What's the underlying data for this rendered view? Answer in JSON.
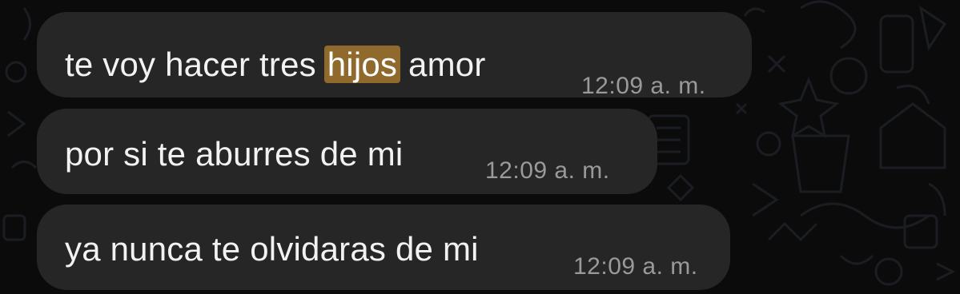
{
  "messages": [
    {
      "text_before": "te voy hacer tres ",
      "highlight": "hijos",
      "text_after": " amor",
      "time": "12:09 a. m."
    },
    {
      "text": "por si te aburres de mi",
      "time": "12:09 a. m."
    },
    {
      "text": "ya nunca te olvidaras de mi",
      "time": "12:09 a. m."
    }
  ],
  "colors": {
    "background": "#0b0b0b",
    "bubble": "#262626",
    "text": "#f2f2f2",
    "timestamp": "#9a9a9a",
    "highlight": "#8f6a2c"
  }
}
